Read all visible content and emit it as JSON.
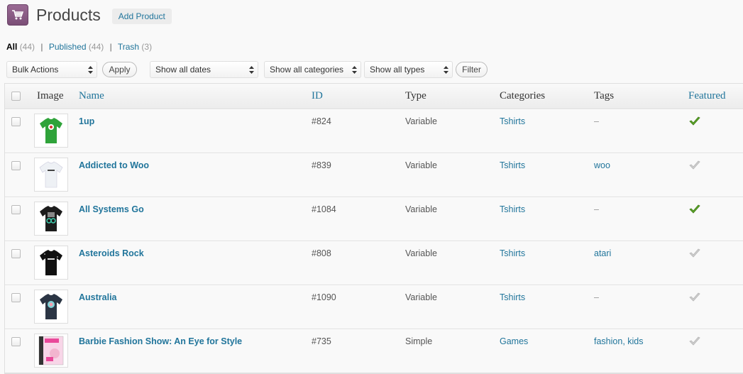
{
  "header": {
    "title": "Products",
    "add_label": "Add Product",
    "icon": "cart-icon"
  },
  "filters_links": {
    "all": {
      "label": "All",
      "count": "(44)"
    },
    "published": {
      "label": "Published",
      "count": "(44)"
    },
    "trash": {
      "label": "Trash",
      "count": "(3)"
    },
    "separator": "|"
  },
  "tablenav": {
    "bulk_actions": "Bulk Actions",
    "apply": "Apply",
    "dates": "Show all dates",
    "categories": "Show all categories",
    "types": "Show all types",
    "filter": "Filter"
  },
  "columns": {
    "image": "Image",
    "name": "Name",
    "id": "ID",
    "type": "Type",
    "categories": "Categories",
    "tags": "Tags",
    "featured": "Featured"
  },
  "rows": [
    {
      "name": "1up",
      "id": "#824",
      "type": "Variable",
      "category": "Tshirts",
      "tags": [
        "–"
      ],
      "featured": true,
      "thumb": "green-tshirt"
    },
    {
      "name": "Addicted to Woo",
      "id": "#839",
      "type": "Variable",
      "category": "Tshirts",
      "tags": [
        "woo"
      ],
      "featured": false,
      "thumb": "white-tshirt"
    },
    {
      "name": "All Systems Go",
      "id": "#1084",
      "type": "Variable",
      "category": "Tshirts",
      "tags": [
        "–"
      ],
      "featured": true,
      "thumb": "black-tshirt"
    },
    {
      "name": "Asteroids Rock",
      "id": "#808",
      "type": "Variable",
      "category": "Tshirts",
      "tags": [
        "atari"
      ],
      "featured": false,
      "thumb": "black-tshirt"
    },
    {
      "name": "Australia",
      "id": "#1090",
      "type": "Variable",
      "category": "Tshirts",
      "tags": [
        "–"
      ],
      "featured": false,
      "thumb": "navy-tshirt"
    },
    {
      "name": "Barbie Fashion Show: An Eye for Style",
      "id": "#735",
      "type": "Simple",
      "category": "Games",
      "tags": [
        "fashion",
        "kids"
      ],
      "featured": false,
      "thumb": "game-box"
    }
  ],
  "colors": {
    "link": "#21759b",
    "featured_on": "#5fa82a",
    "featured_off": "#cfcfcf",
    "green_shirt": "#2fa33a",
    "white_shirt": "#eef1f5",
    "dark_shirt": "#1c1c1c",
    "navy_shirt": "#2b3544",
    "box": "#e9499a"
  }
}
